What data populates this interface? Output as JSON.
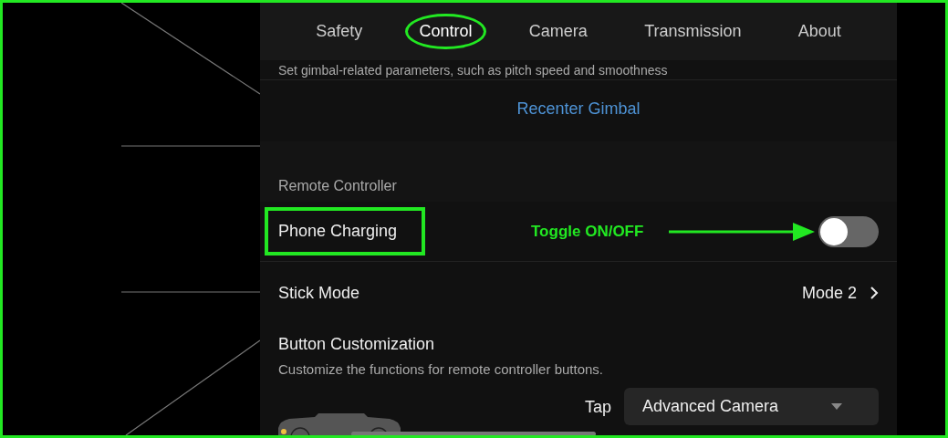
{
  "tabs": [
    {
      "label": "Safety",
      "selected": false
    },
    {
      "label": "Control",
      "selected": true
    },
    {
      "label": "Camera",
      "selected": false
    },
    {
      "label": "Transmission",
      "selected": false
    },
    {
      "label": "About",
      "selected": false
    }
  ],
  "gimbal": {
    "description": "Set gimbal-related parameters, such as pitch speed and smoothness",
    "action": "Recenter Gimbal"
  },
  "remote_controller": {
    "header": "Remote Controller",
    "phone_charging": {
      "label": "Phone Charging",
      "on": false,
      "highlighted": true
    },
    "stick_mode": {
      "label": "Stick Mode",
      "value": "Mode 2"
    },
    "button_customization": {
      "title": "Button Customization",
      "description": "Customize the functions for remote controller buttons.",
      "tap_label": "Tap",
      "tap_value": "Advanced Camera"
    }
  },
  "annotation": {
    "label": "Toggle ON/OFF"
  }
}
